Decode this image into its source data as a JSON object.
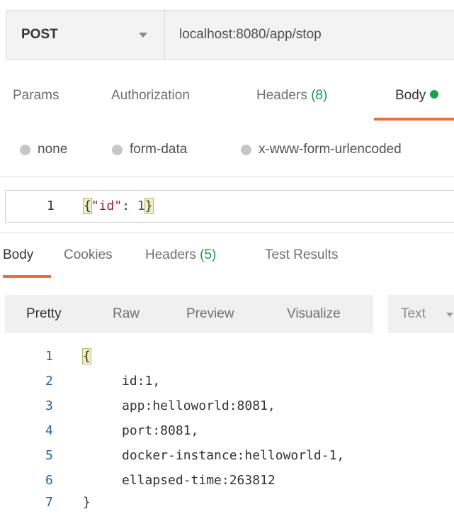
{
  "request": {
    "method": "POST",
    "url": "localhost:8080/app/stop"
  },
  "request_tabs": {
    "params": "Params",
    "authorization": "Authorization",
    "headers_label": "Headers",
    "headers_count": "(8)",
    "body": "Body"
  },
  "body_types": {
    "none": "none",
    "form_data": "form-data",
    "urlencoded": "x-www-form-urlencoded"
  },
  "request_body": {
    "line_no": "1",
    "open_brace": "{",
    "key": "\"id\"",
    "colon": ": ",
    "value": "1",
    "close_brace": "}"
  },
  "response_tabs": {
    "body": "Body",
    "cookies": "Cookies",
    "headers_label": "Headers",
    "headers_count": "(5)",
    "test_results": "Test Results"
  },
  "response_format": {
    "pretty": "Pretty",
    "raw": "Raw",
    "preview": "Preview",
    "visualize": "Visualize",
    "text": "Text"
  },
  "response_body": {
    "lines": [
      {
        "no": "1",
        "text": "{"
      },
      {
        "no": "2",
        "text": "id:1,"
      },
      {
        "no": "3",
        "text": "app:helloworld:8081,"
      },
      {
        "no": "4",
        "text": "port:8081,"
      },
      {
        "no": "5",
        "text": "docker-instance:helloworld-1,"
      },
      {
        "no": "6",
        "text": "ellapsed-time:263812"
      },
      {
        "no": "7",
        "text": "}"
      }
    ]
  },
  "colors": {
    "accent": "#f26b3a",
    "count_green": "#1a9c4c",
    "status_dot": "#1aa34a"
  }
}
